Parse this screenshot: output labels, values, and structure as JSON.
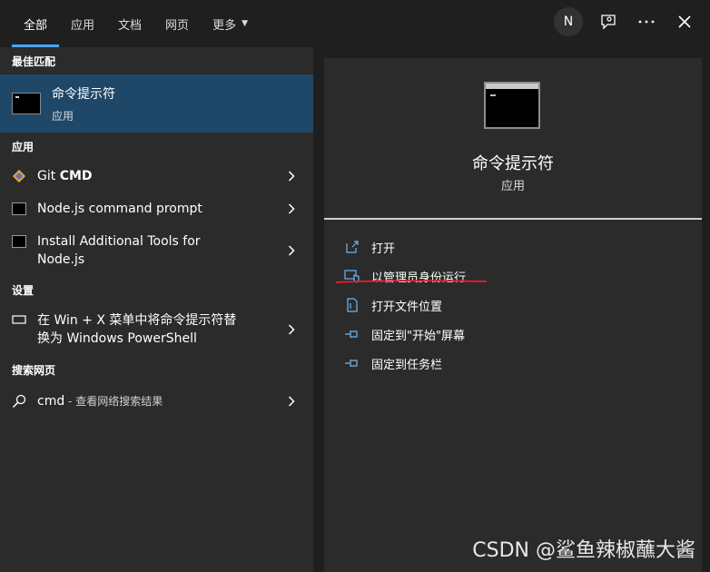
{
  "tabs": [
    {
      "label": "全部"
    },
    {
      "label": "应用"
    },
    {
      "label": "文档"
    },
    {
      "label": "网页"
    },
    {
      "label": "更多"
    }
  ],
  "top": {
    "avatar_letter": "N"
  },
  "left": {
    "best_match_header": "最佳匹配",
    "best_match": {
      "title": "命令提示符",
      "subtitle": "应用"
    },
    "apps_header": "应用",
    "apps": [
      {
        "label_a": "Git ",
        "label_b": "CMD"
      },
      {
        "label": "Node.js command prompt"
      },
      {
        "label_line1": "Install Additional Tools for",
        "label_line2": "Node.js"
      }
    ],
    "settings_header": "设置",
    "settings_item": {
      "line1": "在 Win + X 菜单中将命令提示符替",
      "line2": "换为 Windows PowerShell"
    },
    "web_header": "搜索网页",
    "web_item": {
      "query": "cmd",
      "hint": " - 查看网络搜索结果"
    }
  },
  "detail": {
    "title": "命令提示符",
    "subtitle": "应用",
    "actions": [
      {
        "label": "打开"
      },
      {
        "label": "以管理员身份运行"
      },
      {
        "label": "打开文件位置"
      },
      {
        "label": "固定到\"开始\"屏幕"
      },
      {
        "label": "固定到任务栏"
      }
    ]
  },
  "watermark": "CSDN @鲨鱼辣椒蘸大酱",
  "colors": {
    "accent": "#4aa3f2",
    "selected": "#1e4768",
    "annotation": "#e0202a"
  }
}
